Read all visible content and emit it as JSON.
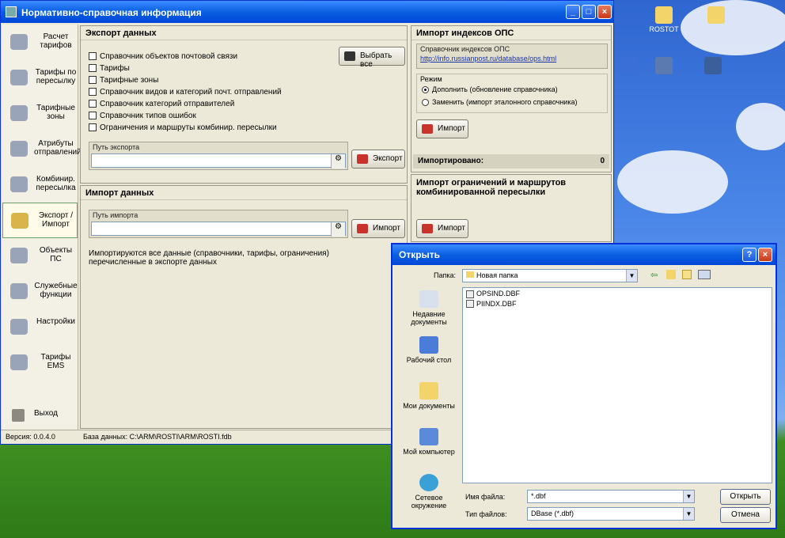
{
  "desktop": {
    "icons": [
      {
        "label": "ROSTOT"
      },
      {
        "label": ""
      },
      {
        "label": ""
      },
      {
        "label": ""
      },
      {
        "label": ""
      }
    ]
  },
  "main_window": {
    "title": "Нормативно-справочная информация",
    "nav": [
      {
        "label": "Расчет тарифов"
      },
      {
        "label": "Тарифы по пересылку"
      },
      {
        "label": "Тарифные зоны"
      },
      {
        "label": "Атрибуты отправлений"
      },
      {
        "label": "Комбинир. пересылка"
      },
      {
        "label": "Экспорт / Импорт"
      },
      {
        "label": "Объекты ПС"
      },
      {
        "label": "Служебные функции"
      },
      {
        "label": "Настройки"
      },
      {
        "label": "Тарифы ЕМS"
      }
    ],
    "logout_label": "Выход",
    "export": {
      "header": "Экспорт данных",
      "checkboxes": [
        "Справочник объектов почтовой связи",
        "Тарифы",
        "Тарифные зоны",
        "Справочник видов и категорий почт. отправлений",
        "Справочник категорий отправителей",
        "Справочник типов ошибок",
        "Ограничения и маршруты комбинир. пересылки"
      ],
      "select_all": "Выбрать все",
      "path_label": "Путь экспорта",
      "path_value": "",
      "button": "Экспорт"
    },
    "import": {
      "header": "Импорт данных",
      "path_label": "Путь импорта",
      "path_value": "",
      "button": "Импорт",
      "note": "Импортируются все данные (справочники, тарифы, ограничения) перечисленные в экспорте данных"
    },
    "index_import": {
      "header": "Импорт индексов ОПС",
      "group_label": "Справочник индексов ОПС",
      "url": "http://info.russianpost.ru/database/ops.html",
      "mode_label": "Режим",
      "mode_add": "Дополнить (обновление справочника)",
      "mode_replace": "Заменить (импорт эталонного справочника)",
      "button": "Импорт",
      "imported_label": "Импортировано:",
      "imported_count": "0"
    },
    "route_import": {
      "header": "Импорт ограничений и маршрутов комбинированной пересылки",
      "button": "Импорт"
    },
    "status": {
      "version": "Версия: 0.0.4.0",
      "db": "База данных: C:\\ARM\\ROSTI\\ARM\\ROSTI.fdb"
    }
  },
  "dialog": {
    "title": "Открыть",
    "folder_label": "Папка:",
    "folder_value": "Новая папка",
    "places": [
      "Недавние документы",
      "Рабочий стол",
      "Мои документы",
      "Мой компьютер",
      "Сетевое окружение"
    ],
    "files": [
      "OPSIND.DBF",
      "PIINDX.DBF"
    ],
    "filename_label": "Имя файла:",
    "filename_value": "*.dbf",
    "filetype_label": "Тип файлов:",
    "filetype_value": "DBase (*.dbf)",
    "open_button": "Открыть",
    "cancel_button": "Отмена"
  }
}
